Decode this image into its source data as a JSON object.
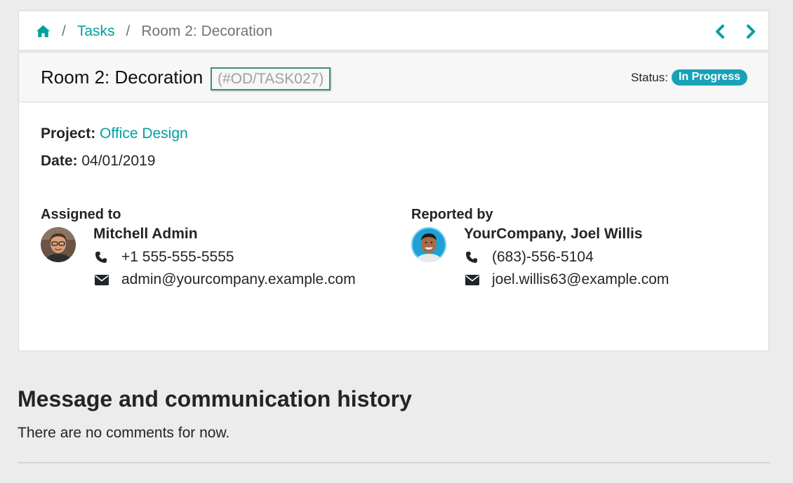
{
  "breadcrumb": {
    "home_icon": "home-icon",
    "separator": "/",
    "tasks_link": "Tasks",
    "current": "Room 2: Decoration",
    "prev_icon": "chevron-left-icon",
    "next_icon": "chevron-right-icon"
  },
  "task": {
    "title": "Room 2: Decoration",
    "reference": "(#OD/TASK027)",
    "status_label": "Status:",
    "status_value": "In Progress",
    "project_label": "Project:",
    "project_value": "Office Design",
    "date_label": "Date:",
    "date_value": "04/01/2019"
  },
  "assigned": {
    "heading": "Assigned to",
    "name": "Mitchell Admin",
    "phone": "+1 555-555-5555",
    "email": "admin@yourcompany.example.com"
  },
  "reported": {
    "heading": "Reported by",
    "name": "YourCompany, Joel Willis",
    "phone": "(683)-556-5104",
    "email": "joel.willis63@example.com"
  },
  "history": {
    "title": "Message and communication history",
    "empty": "There are no comments for now."
  },
  "colors": {
    "accent": "#00a09d",
    "status_badge": "#17a2b8",
    "background": "#ececec"
  }
}
